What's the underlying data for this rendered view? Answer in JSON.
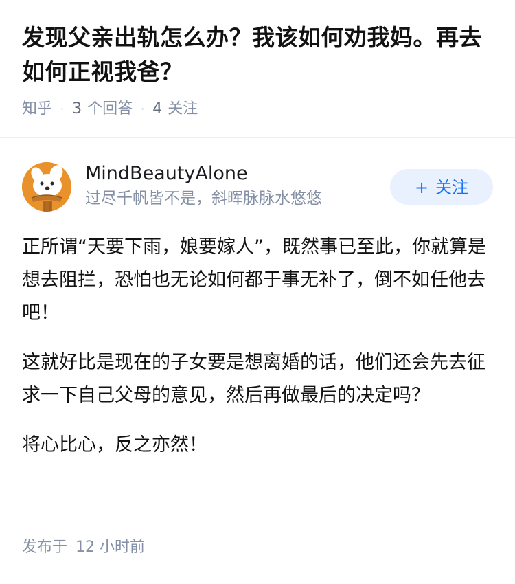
{
  "question": {
    "title": "发现父亲出轨怎么办？我该如何劝我妈。再去如何正视我爸？",
    "meta": {
      "source": "知乎",
      "answers_count": "3",
      "answers_label": "个回答",
      "followers_count": "4",
      "followers_label": "关注",
      "separator": "·"
    }
  },
  "answer": {
    "author": {
      "name": "MindBeautyAlone",
      "bio": "过尽千帆皆不是，斜晖脉脉水悠悠",
      "avatar_icon": "cartoon-dog-avatar-icon"
    },
    "follow_button": {
      "plus": "+",
      "label": "关注"
    },
    "paragraphs": [
      "正所谓“天要下雨，娘要嫁人”，既然事已至此，你就算是想去阻拦，恐怕也无论如何都于事无补了，倒不如任他去吧！",
      "这就好比是现在的子女要是想离婚的话，他们还会先去征求一下自己父母的意见，然后再做最后的决定吗？",
      "将心比心，反之亦然！"
    ],
    "publish": {
      "label": "发布于",
      "time": "12 小时前"
    }
  },
  "colors": {
    "accent": "#1772f6",
    "follow_bg": "#e8f1fd",
    "meta_gray": "#8590a6",
    "avatar_orange": "#e9912a"
  }
}
